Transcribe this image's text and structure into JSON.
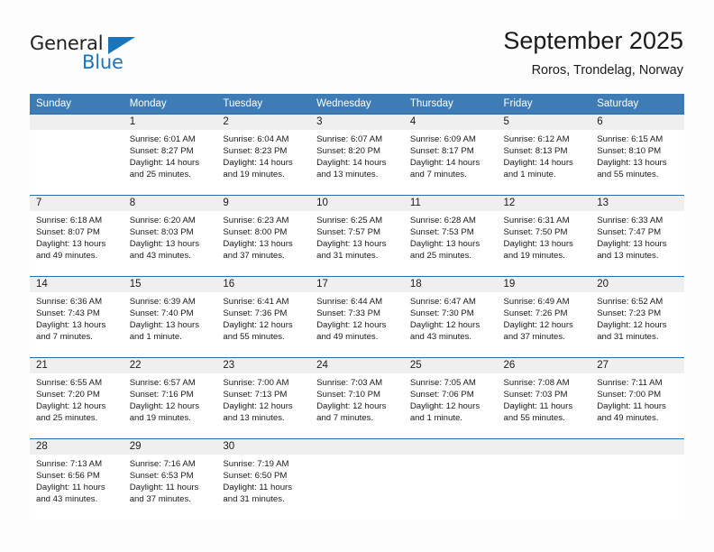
{
  "brand": {
    "name_part1": "General",
    "name_part2": "Blue",
    "triangle_icon": "triangle-icon",
    "color_dark": "#231f20",
    "color_blue": "#1b75bb"
  },
  "header": {
    "title": "September 2025",
    "subtitle": "Roros, Trondelag, Norway"
  },
  "theme": {
    "header_bg": "#3d7cb5",
    "row_divider": "#2c6ba5",
    "daynum_bg": "#efefef",
    "text": "#1a1a1a"
  },
  "weekday_headers": [
    "Sunday",
    "Monday",
    "Tuesday",
    "Wednesday",
    "Thursday",
    "Friday",
    "Saturday"
  ],
  "weeks": [
    [
      {
        "day": "",
        "sunrise": "",
        "sunset": "",
        "daylight_line1": "",
        "daylight_line2": "",
        "empty": true
      },
      {
        "day": "1",
        "sunrise": "Sunrise: 6:01 AM",
        "sunset": "Sunset: 8:27 PM",
        "daylight_line1": "Daylight: 14 hours",
        "daylight_line2": "and 25 minutes.",
        "empty": false
      },
      {
        "day": "2",
        "sunrise": "Sunrise: 6:04 AM",
        "sunset": "Sunset: 8:23 PM",
        "daylight_line1": "Daylight: 14 hours",
        "daylight_line2": "and 19 minutes.",
        "empty": false
      },
      {
        "day": "3",
        "sunrise": "Sunrise: 6:07 AM",
        "sunset": "Sunset: 8:20 PM",
        "daylight_line1": "Daylight: 14 hours",
        "daylight_line2": "and 13 minutes.",
        "empty": false
      },
      {
        "day": "4",
        "sunrise": "Sunrise: 6:09 AM",
        "sunset": "Sunset: 8:17 PM",
        "daylight_line1": "Daylight: 14 hours",
        "daylight_line2": "and 7 minutes.",
        "empty": false
      },
      {
        "day": "5",
        "sunrise": "Sunrise: 6:12 AM",
        "sunset": "Sunset: 8:13 PM",
        "daylight_line1": "Daylight: 14 hours",
        "daylight_line2": "and 1 minute.",
        "empty": false
      },
      {
        "day": "6",
        "sunrise": "Sunrise: 6:15 AM",
        "sunset": "Sunset: 8:10 PM",
        "daylight_line1": "Daylight: 13 hours",
        "daylight_line2": "and 55 minutes.",
        "empty": false
      }
    ],
    [
      {
        "day": "7",
        "sunrise": "Sunrise: 6:18 AM",
        "sunset": "Sunset: 8:07 PM",
        "daylight_line1": "Daylight: 13 hours",
        "daylight_line2": "and 49 minutes.",
        "empty": false
      },
      {
        "day": "8",
        "sunrise": "Sunrise: 6:20 AM",
        "sunset": "Sunset: 8:03 PM",
        "daylight_line1": "Daylight: 13 hours",
        "daylight_line2": "and 43 minutes.",
        "empty": false
      },
      {
        "day": "9",
        "sunrise": "Sunrise: 6:23 AM",
        "sunset": "Sunset: 8:00 PM",
        "daylight_line1": "Daylight: 13 hours",
        "daylight_line2": "and 37 minutes.",
        "empty": false
      },
      {
        "day": "10",
        "sunrise": "Sunrise: 6:25 AM",
        "sunset": "Sunset: 7:57 PM",
        "daylight_line1": "Daylight: 13 hours",
        "daylight_line2": "and 31 minutes.",
        "empty": false
      },
      {
        "day": "11",
        "sunrise": "Sunrise: 6:28 AM",
        "sunset": "Sunset: 7:53 PM",
        "daylight_line1": "Daylight: 13 hours",
        "daylight_line2": "and 25 minutes.",
        "empty": false
      },
      {
        "day": "12",
        "sunrise": "Sunrise: 6:31 AM",
        "sunset": "Sunset: 7:50 PM",
        "daylight_line1": "Daylight: 13 hours",
        "daylight_line2": "and 19 minutes.",
        "empty": false
      },
      {
        "day": "13",
        "sunrise": "Sunrise: 6:33 AM",
        "sunset": "Sunset: 7:47 PM",
        "daylight_line1": "Daylight: 13 hours",
        "daylight_line2": "and 13 minutes.",
        "empty": false
      }
    ],
    [
      {
        "day": "14",
        "sunrise": "Sunrise: 6:36 AM",
        "sunset": "Sunset: 7:43 PM",
        "daylight_line1": "Daylight: 13 hours",
        "daylight_line2": "and 7 minutes.",
        "empty": false
      },
      {
        "day": "15",
        "sunrise": "Sunrise: 6:39 AM",
        "sunset": "Sunset: 7:40 PM",
        "daylight_line1": "Daylight: 13 hours",
        "daylight_line2": "and 1 minute.",
        "empty": false
      },
      {
        "day": "16",
        "sunrise": "Sunrise: 6:41 AM",
        "sunset": "Sunset: 7:36 PM",
        "daylight_line1": "Daylight: 12 hours",
        "daylight_line2": "and 55 minutes.",
        "empty": false
      },
      {
        "day": "17",
        "sunrise": "Sunrise: 6:44 AM",
        "sunset": "Sunset: 7:33 PM",
        "daylight_line1": "Daylight: 12 hours",
        "daylight_line2": "and 49 minutes.",
        "empty": false
      },
      {
        "day": "18",
        "sunrise": "Sunrise: 6:47 AM",
        "sunset": "Sunset: 7:30 PM",
        "daylight_line1": "Daylight: 12 hours",
        "daylight_line2": "and 43 minutes.",
        "empty": false
      },
      {
        "day": "19",
        "sunrise": "Sunrise: 6:49 AM",
        "sunset": "Sunset: 7:26 PM",
        "daylight_line1": "Daylight: 12 hours",
        "daylight_line2": "and 37 minutes.",
        "empty": false
      },
      {
        "day": "20",
        "sunrise": "Sunrise: 6:52 AM",
        "sunset": "Sunset: 7:23 PM",
        "daylight_line1": "Daylight: 12 hours",
        "daylight_line2": "and 31 minutes.",
        "empty": false
      }
    ],
    [
      {
        "day": "21",
        "sunrise": "Sunrise: 6:55 AM",
        "sunset": "Sunset: 7:20 PM",
        "daylight_line1": "Daylight: 12 hours",
        "daylight_line2": "and 25 minutes.",
        "empty": false
      },
      {
        "day": "22",
        "sunrise": "Sunrise: 6:57 AM",
        "sunset": "Sunset: 7:16 PM",
        "daylight_line1": "Daylight: 12 hours",
        "daylight_line2": "and 19 minutes.",
        "empty": false
      },
      {
        "day": "23",
        "sunrise": "Sunrise: 7:00 AM",
        "sunset": "Sunset: 7:13 PM",
        "daylight_line1": "Daylight: 12 hours",
        "daylight_line2": "and 13 minutes.",
        "empty": false
      },
      {
        "day": "24",
        "sunrise": "Sunrise: 7:03 AM",
        "sunset": "Sunset: 7:10 PM",
        "daylight_line1": "Daylight: 12 hours",
        "daylight_line2": "and 7 minutes.",
        "empty": false
      },
      {
        "day": "25",
        "sunrise": "Sunrise: 7:05 AM",
        "sunset": "Sunset: 7:06 PM",
        "daylight_line1": "Daylight: 12 hours",
        "daylight_line2": "and 1 minute.",
        "empty": false
      },
      {
        "day": "26",
        "sunrise": "Sunrise: 7:08 AM",
        "sunset": "Sunset: 7:03 PM",
        "daylight_line1": "Daylight: 11 hours",
        "daylight_line2": "and 55 minutes.",
        "empty": false
      },
      {
        "day": "27",
        "sunrise": "Sunrise: 7:11 AM",
        "sunset": "Sunset: 7:00 PM",
        "daylight_line1": "Daylight: 11 hours",
        "daylight_line2": "and 49 minutes.",
        "empty": false
      }
    ],
    [
      {
        "day": "28",
        "sunrise": "Sunrise: 7:13 AM",
        "sunset": "Sunset: 6:56 PM",
        "daylight_line1": "Daylight: 11 hours",
        "daylight_line2": "and 43 minutes.",
        "empty": false
      },
      {
        "day": "29",
        "sunrise": "Sunrise: 7:16 AM",
        "sunset": "Sunset: 6:53 PM",
        "daylight_line1": "Daylight: 11 hours",
        "daylight_line2": "and 37 minutes.",
        "empty": false
      },
      {
        "day": "30",
        "sunrise": "Sunrise: 7:19 AM",
        "sunset": "Sunset: 6:50 PM",
        "daylight_line1": "Daylight: 11 hours",
        "daylight_line2": "and 31 minutes.",
        "empty": false
      },
      {
        "day": "",
        "sunrise": "",
        "sunset": "",
        "daylight_line1": "",
        "daylight_line2": "",
        "empty": true
      },
      {
        "day": "",
        "sunrise": "",
        "sunset": "",
        "daylight_line1": "",
        "daylight_line2": "",
        "empty": true
      },
      {
        "day": "",
        "sunrise": "",
        "sunset": "",
        "daylight_line1": "",
        "daylight_line2": "",
        "empty": true
      },
      {
        "day": "",
        "sunrise": "",
        "sunset": "",
        "daylight_line1": "",
        "daylight_line2": "",
        "empty": true
      }
    ]
  ]
}
